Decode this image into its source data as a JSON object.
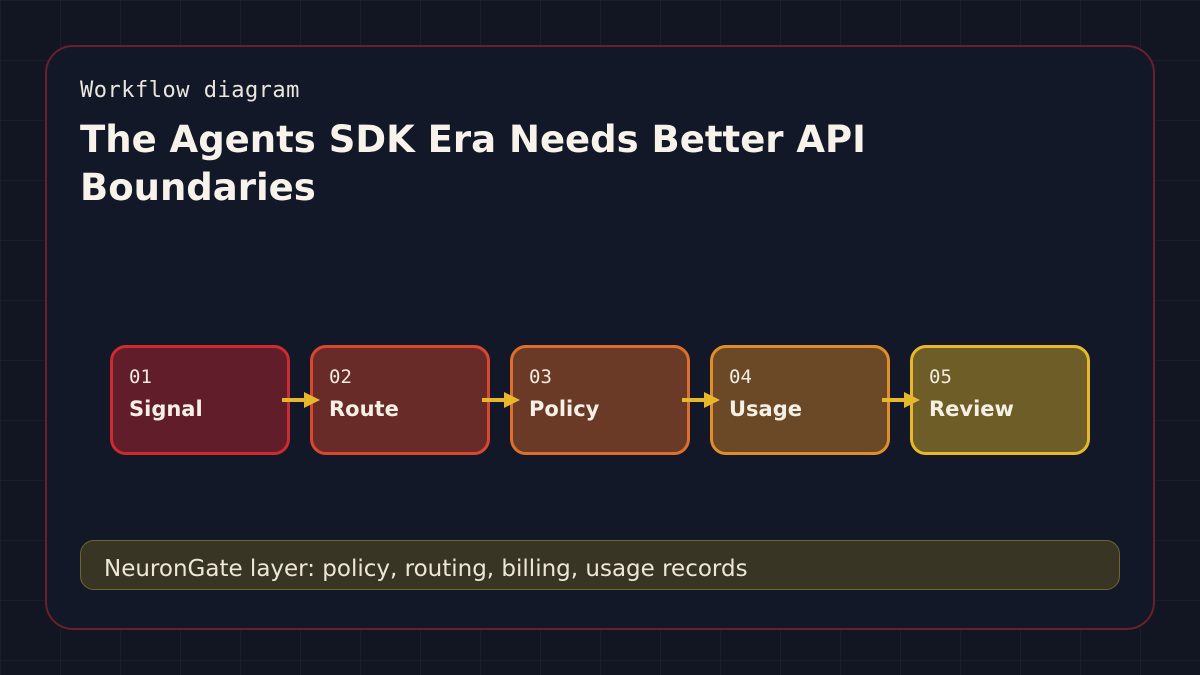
{
  "header": {
    "eyebrow": "Workflow diagram",
    "title": "The Agents SDK Era Needs Better API Boundaries"
  },
  "steps": [
    {
      "number": "01",
      "label": "Signal"
    },
    {
      "number": "02",
      "label": "Route"
    },
    {
      "number": "03",
      "label": "Policy"
    },
    {
      "number": "04",
      "label": "Usage"
    },
    {
      "number": "05",
      "label": "Review"
    }
  ],
  "footer": {
    "text": "NeuronGate layer: policy, routing, billing, usage records"
  },
  "colors": {
    "background": "#111622",
    "card_border": "#6b1f2c",
    "arrow": "#e8b82c",
    "step_borders": [
      "#cc2b2f",
      "#d9482e",
      "#df6e2c",
      "#e28e28",
      "#e8b82c"
    ]
  }
}
